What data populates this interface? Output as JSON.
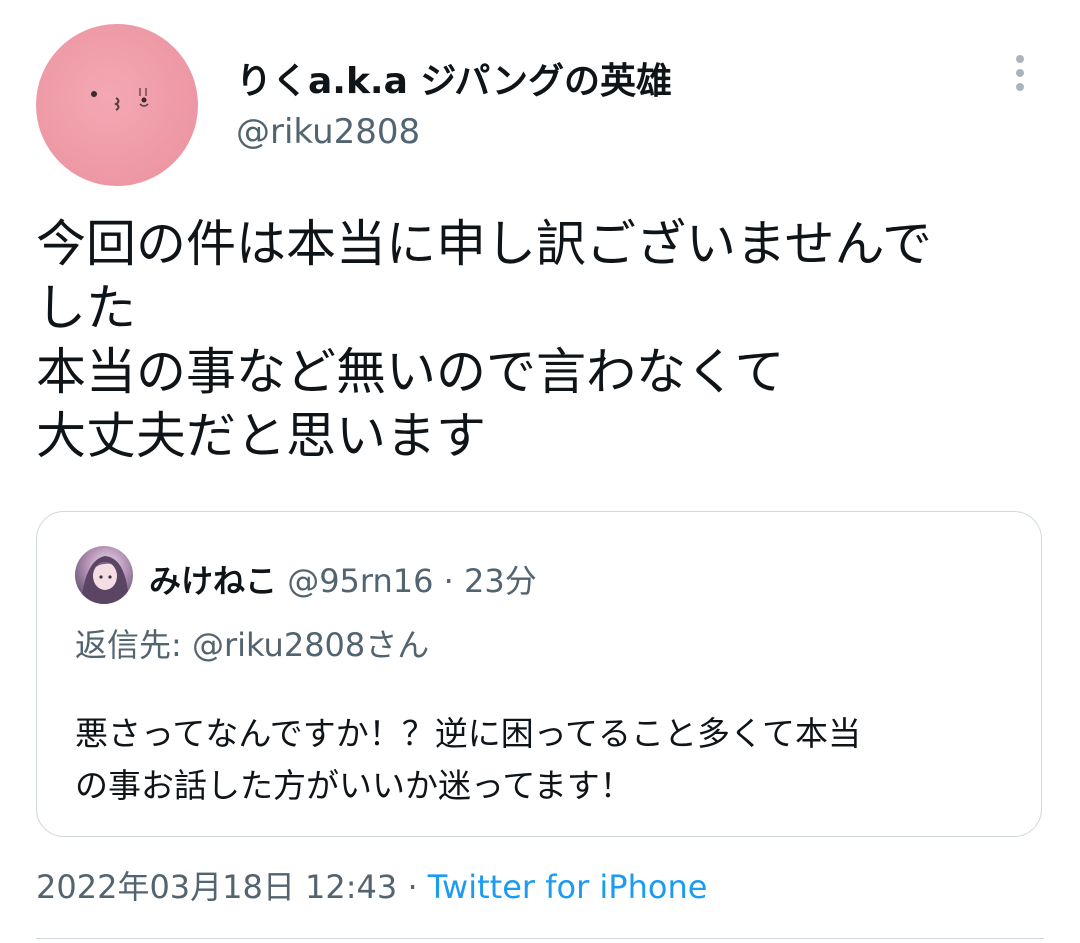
{
  "author": {
    "display_name": "りくa.k.a ジパングの英雄",
    "handle": "@riku2808",
    "avatar_icon": "pink-blob-face-avatar",
    "avatar_color": "#ee9aa6"
  },
  "more_icon": "vertical-ellipsis-icon",
  "tweet": {
    "lines": [
      "今回の件は本当に申し訳ございませんで",
      "した",
      "本当の事など無いので言わなくて",
      "大丈夫だと思います"
    ]
  },
  "quoted": {
    "display_name": "みけねこ",
    "handle": "@95rn16",
    "separator": "·",
    "time": "23分",
    "replying_to": "返信先: @riku2808さん",
    "avatar_icon": "anime-girl-avatar",
    "lines": [
      "悪さってなんですか！？逆に困ってること多くて本当",
      "の事お話した方がいいか迷ってます！"
    ]
  },
  "meta": {
    "timestamp": "2022年03月18日 12:43",
    "separator": "·",
    "source": "Twitter for iPhone",
    "source_color": "#1d9bf0"
  }
}
